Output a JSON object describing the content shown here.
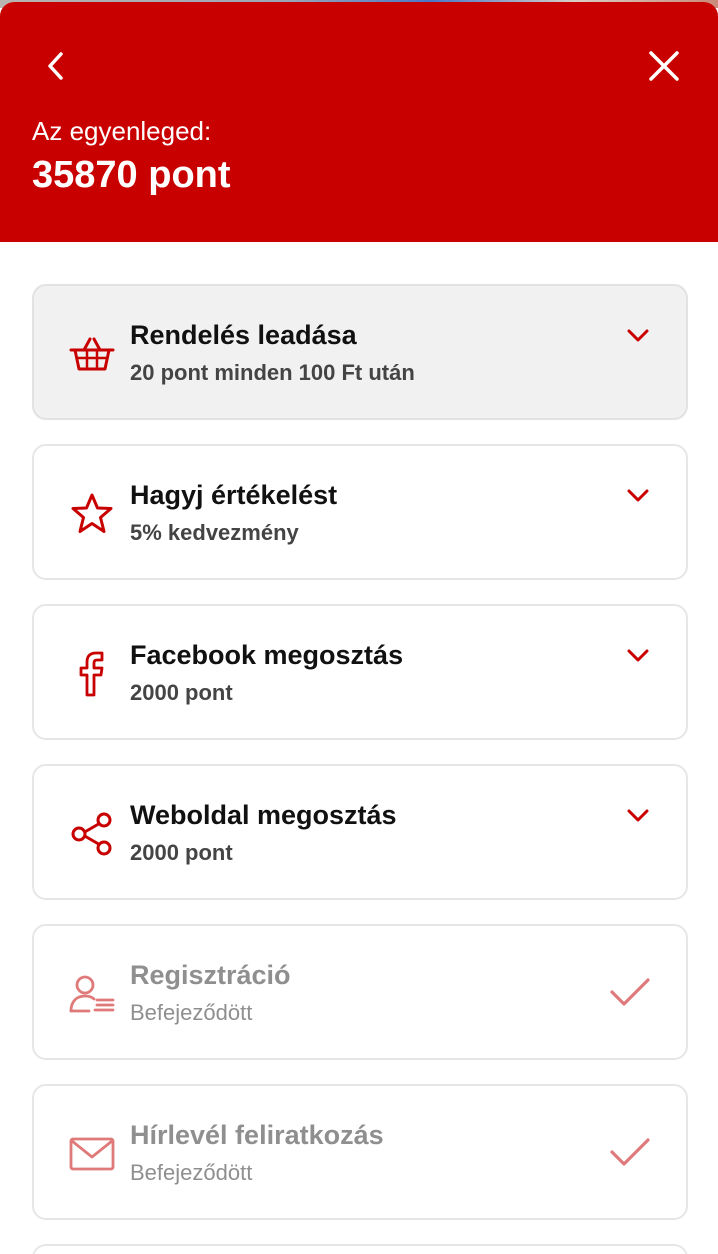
{
  "header": {
    "back_icon": "chevron-left-icon",
    "close_icon": "close-icon",
    "balance_label": "Az egyenleged:",
    "balance_value": "35870 pont",
    "background_color": "#c90000"
  },
  "colors": {
    "accent": "#c90000",
    "done_accent": "#e07a7a",
    "card_active_bg": "#f1f1f1",
    "card_border": "#e6e6e6"
  },
  "items": [
    {
      "title": "Rendelés leadása",
      "subtitle": "20 pont minden 100 Ft után",
      "icon": "basket-icon",
      "state": "expandable",
      "highlighted": true
    },
    {
      "title": "Hagyj értékelést",
      "subtitle": "5% kedvezmény",
      "icon": "star-icon",
      "state": "expandable"
    },
    {
      "title": "Facebook megosztás",
      "subtitle": "2000 pont",
      "icon": "facebook-icon",
      "state": "expandable"
    },
    {
      "title": "Weboldal megosztás",
      "subtitle": "2000 pont",
      "icon": "share-icon",
      "state": "expandable"
    },
    {
      "title": "Regisztráció",
      "subtitle": "Befejeződött",
      "icon": "user-register-icon",
      "state": "completed"
    },
    {
      "title": "Hírlevél feliratkozás",
      "subtitle": "Befejeződött",
      "icon": "envelope-icon",
      "state": "completed"
    }
  ]
}
